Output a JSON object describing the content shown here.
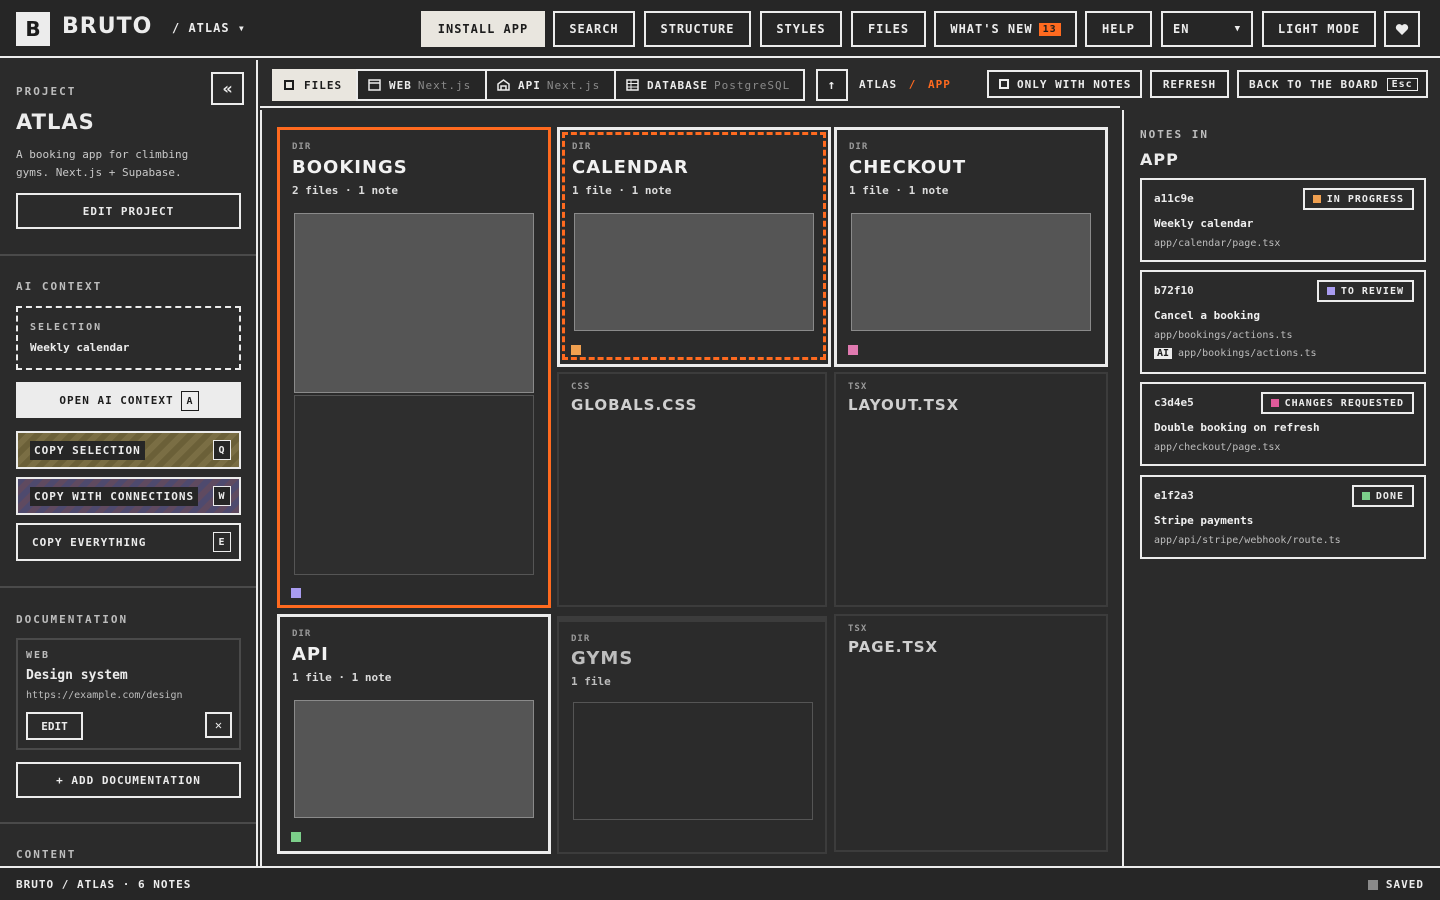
{
  "app": {
    "logo_letter": "B",
    "name": "BRUTO",
    "project_crumb": "/ ATLAS ▾"
  },
  "topbar": {
    "install": "INSTALL APP",
    "search": "SEARCH",
    "structure": "STRUCTURE",
    "styles": "STYLES",
    "files": "FILES",
    "whats_new": "WHAT'S NEW",
    "whats_new_count": "13",
    "help": "HELP",
    "language": "EN",
    "light_mode": "LIGHT MODE",
    "favorite_icon": "heart-icon"
  },
  "sidebar": {
    "project_label": "PROJECT",
    "project_name": "ATLAS",
    "project_desc": "A booking app for climbing gyms. Next.js + Supabase.",
    "edit_project": "EDIT PROJECT",
    "ai_context_label": "AI CONTEXT",
    "selection_label": "SELECTION",
    "selection_value": "Weekly calendar",
    "open_ai": "OPEN AI CONTEXT",
    "open_ai_key": "A",
    "copy_selection": "COPY SELECTION",
    "copy_selection_key": "Q",
    "copy_connections": "COPY WITH CONNECTIONS",
    "copy_connections_key": "W",
    "copy_everything": "COPY EVERYTHING",
    "copy_everything_key": "E",
    "documentation_label": "DOCUMENTATION",
    "doc_kind": "WEB",
    "doc_title": "Design system",
    "doc_url": "https://example.com/design",
    "doc_edit": "EDIT",
    "doc_remove": "✕",
    "add_doc": "+ ADD DOCUMENTATION",
    "content_label": "CONTENT"
  },
  "tabs": [
    {
      "label": "FILES",
      "sub": "",
      "icon": "square-icon"
    },
    {
      "label": "WEB",
      "sub": "Next.js",
      "icon": "window-icon"
    },
    {
      "label": "API",
      "sub": "Next.js",
      "icon": "building-icon"
    },
    {
      "label": "DATABASE",
      "sub": "PostgreSQL",
      "icon": "table-icon"
    }
  ],
  "path": {
    "root": "ATLAS",
    "sep": "/",
    "current": "APP"
  },
  "toolbar": {
    "only_notes": "ONLY WITH NOTES",
    "refresh": "REFRESH",
    "back": "BACK TO THE BOARD",
    "back_key": "Esc"
  },
  "cards": [
    {
      "kind": "DIR",
      "title": "BOOKINGS",
      "meta": "2 files · 1 note",
      "marker": "#a99cf0"
    },
    {
      "kind": "DIR",
      "title": "CALENDAR",
      "meta": "1 file · 1 note",
      "marker": "#f0a050"
    },
    {
      "kind": "DIR",
      "title": "CHECKOUT",
      "meta": "1 file · 1 note",
      "marker": "#e07ab0"
    },
    {
      "kind": "CSS",
      "title": "GLOBALS.CSS",
      "meta": ""
    },
    {
      "kind": "TSX",
      "title": "LAYOUT.TSX",
      "meta": ""
    },
    {
      "kind": "DIR",
      "title": "API",
      "meta": "1 file · 1 note",
      "marker": "#7ccf8a"
    },
    {
      "kind": "DIR",
      "title": "GYMS",
      "meta": "1 file"
    },
    {
      "kind": "TSX",
      "title": "PAGE.TSX",
      "meta": ""
    }
  ],
  "notes_panel": {
    "label": "NOTES IN",
    "folder": "APP"
  },
  "notes": [
    {
      "id": "a11c9e",
      "status": "IN PROGRESS",
      "color": "#f0a050",
      "title": "Weekly calendar",
      "path": "app/calendar/page.tsx",
      "ai_tag": "",
      "ai_path": ""
    },
    {
      "id": "b72f10",
      "status": "TO REVIEW",
      "color": "#a99cf0",
      "title": "Cancel a booking",
      "path": "app/bookings/actions.ts",
      "ai_tag": "AI",
      "ai_path": "app/bookings/actions.ts"
    },
    {
      "id": "c3d4e5",
      "status": "CHANGES REQUESTED",
      "color": "#e05a9a",
      "title": "Double booking on refresh",
      "path": "app/checkout/page.tsx",
      "ai_tag": "",
      "ai_path": ""
    },
    {
      "id": "e1f2a3",
      "status": "DONE",
      "color": "#7ccf8a",
      "title": "Stripe payments",
      "path": "app/api/stripe/webhook/route.ts",
      "ai_tag": "",
      "ai_path": ""
    }
  ],
  "status": {
    "left": "BRUTO / ATLAS · 6 NOTES",
    "right": "SAVED"
  }
}
